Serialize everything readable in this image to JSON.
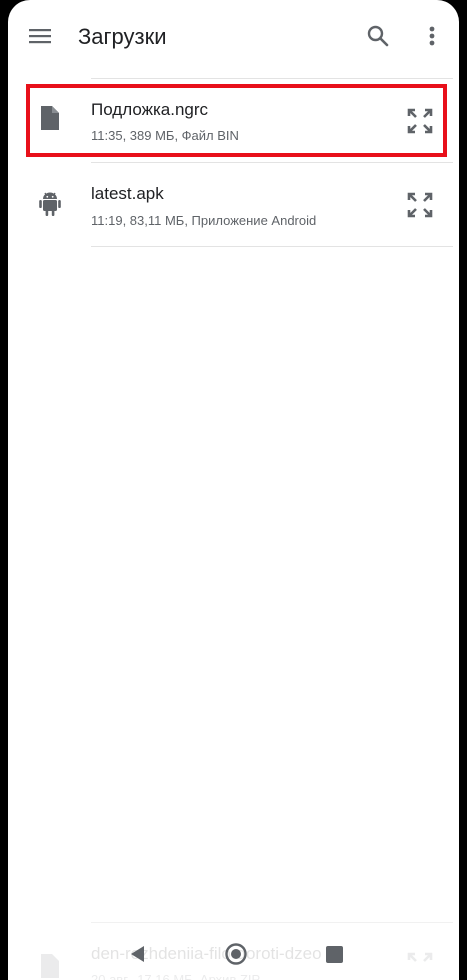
{
  "app": {
    "title": "Загрузки"
  },
  "files": [
    {
      "name": "Подложка.ngrc",
      "meta": "11:35, 389 МБ, Файл BIN",
      "icon": "document-icon"
    },
    {
      "name": "latest.apk",
      "meta": "11:19, 83,11 МБ, Приложение Android",
      "icon": "android-icon"
    },
    {
      "name": "den-rozhdeniia-filo-doroti-dzeo",
      "meta": "20 авг., 17,16 МБ, Архив ZIP",
      "icon": "zip-icon"
    }
  ],
  "colors": {
    "highlight": "#e8101a",
    "text_primary": "#202124",
    "text_secondary": "#5f6368",
    "icon": "#5f6368"
  },
  "navigation": [
    "back",
    "home",
    "recents"
  ]
}
